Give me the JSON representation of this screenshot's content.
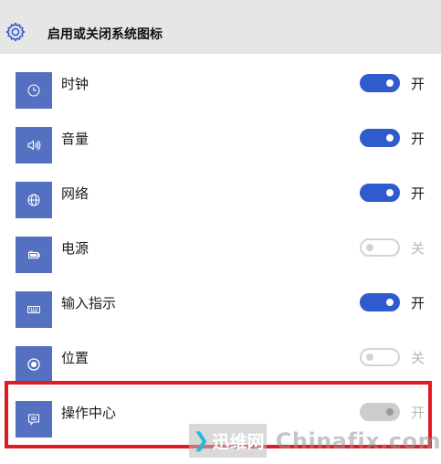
{
  "header": {
    "title": "启用或关闭系统图标",
    "icon": "gear-icon"
  },
  "colors": {
    "tile": "#5470c0",
    "toggle_on": "#2f5bcd",
    "highlight": "#e01b22"
  },
  "items": [
    {
      "label": "时钟",
      "icon": "clock-icon",
      "toggle": "on",
      "state_label": "开"
    },
    {
      "label": "音量",
      "icon": "volume-icon",
      "toggle": "on",
      "state_label": "开"
    },
    {
      "label": "网络",
      "icon": "globe-icon",
      "toggle": "on",
      "state_label": "开"
    },
    {
      "label": "电源",
      "icon": "battery-icon",
      "toggle": "off",
      "state_label": "关"
    },
    {
      "label": "输入指示",
      "icon": "keyboard-icon",
      "toggle": "on",
      "state_label": "开"
    },
    {
      "label": "位置",
      "icon": "location-icon",
      "toggle": "off",
      "state_label": "关"
    },
    {
      "label": "操作中心",
      "icon": "action-center-icon",
      "toggle": "disabled",
      "state_label": "开"
    }
  ],
  "watermark": {
    "logo_text": "迅维网",
    "site": "Chinafix.com"
  }
}
